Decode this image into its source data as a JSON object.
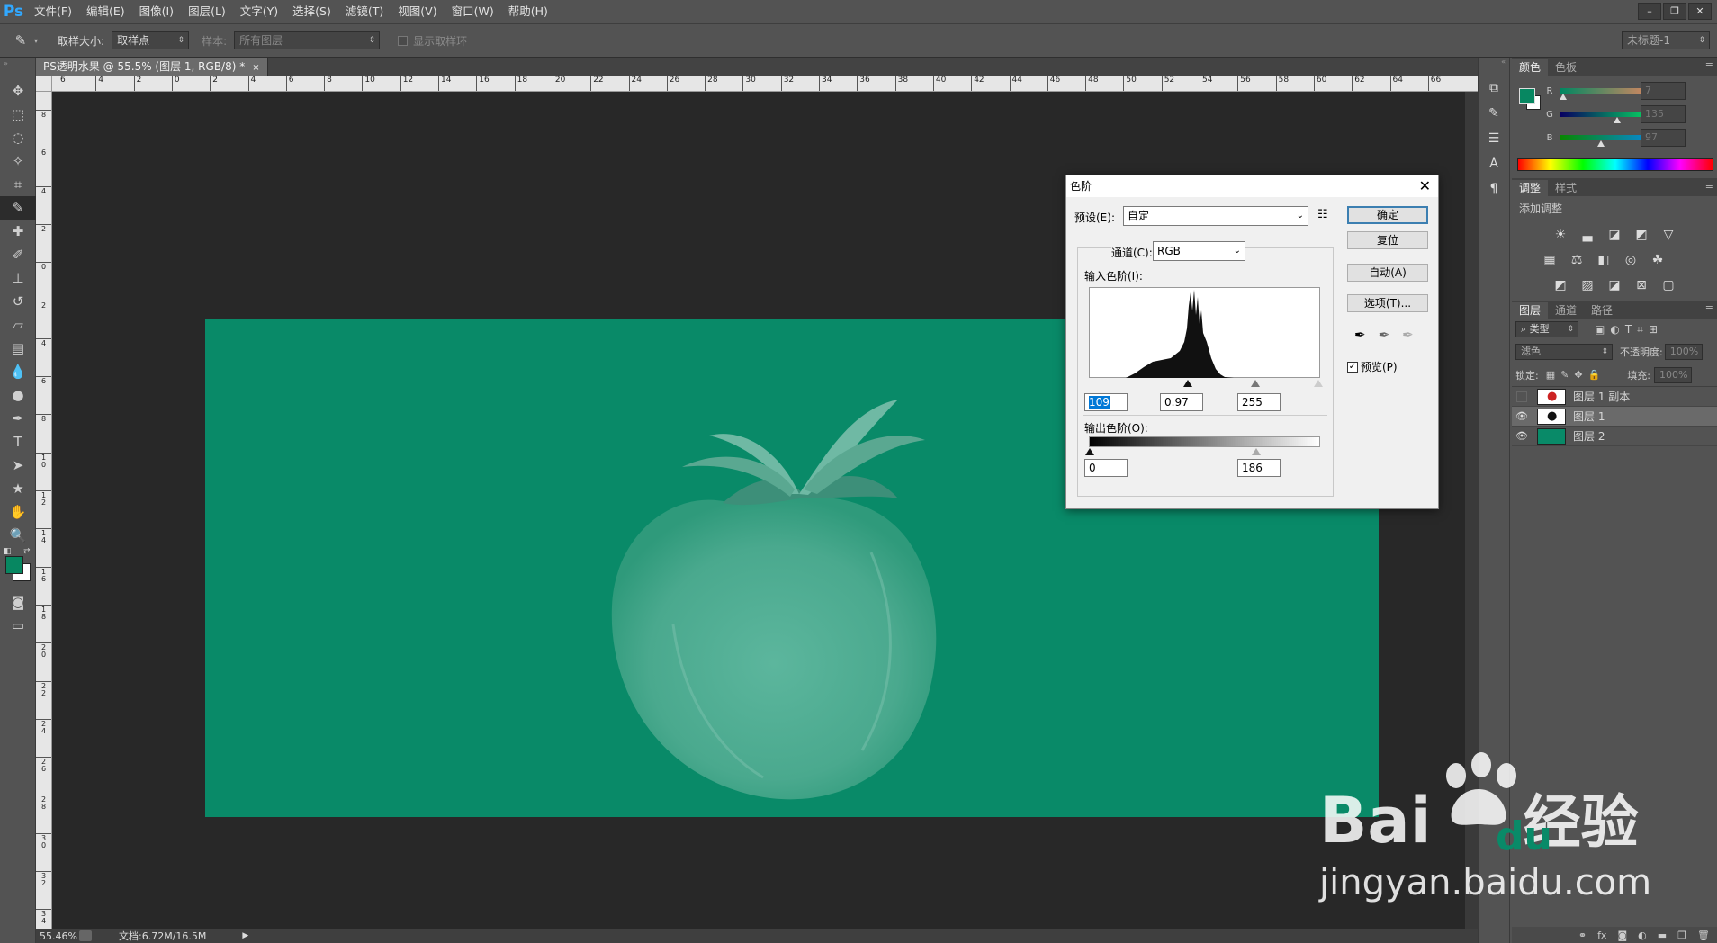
{
  "menubar": {
    "logo": "Ps",
    "items": [
      "文件(F)",
      "编辑(E)",
      "图像(I)",
      "图层(L)",
      "文字(Y)",
      "选择(S)",
      "滤镜(T)",
      "视图(V)",
      "窗口(W)",
      "帮助(H)"
    ]
  },
  "options": {
    "sample_size_label": "取样大小:",
    "sample_size_value": "取样点",
    "sample_label": "样本:",
    "sample_value": "所有图层",
    "show_ring_label": "显示取样环",
    "workspace": "未标题-1"
  },
  "document": {
    "tab_title": "PS透明水果 @ 55.5% (图层 1, RGB/8) *",
    "canvas_color": "#098a68",
    "ruler_h": [
      "6",
      "4",
      "2",
      "0",
      "2",
      "4",
      "6",
      "8",
      "10",
      "12",
      "14",
      "16",
      "18",
      "20",
      "22",
      "24",
      "26",
      "28",
      "30",
      "32",
      "34",
      "36",
      "38",
      "40",
      "42",
      "44",
      "46",
      "48",
      "50",
      "52",
      "54",
      "56",
      "58",
      "60",
      "62",
      "64",
      "66"
    ],
    "ruler_v": [
      "8",
      "6",
      "4",
      "2",
      "0",
      "2",
      "4",
      "6",
      "8",
      "10",
      "12",
      "14",
      "16",
      "18",
      "20",
      "22",
      "24",
      "26",
      "28",
      "30",
      "32",
      "34"
    ]
  },
  "status": {
    "zoom": "55.46%",
    "doc": "文档:6.72M/16.5M"
  },
  "color_panel": {
    "tabs": [
      "颜色",
      "色板"
    ],
    "r_label": "R",
    "g_label": "G",
    "b_label": "B",
    "r": "7",
    "g": "135",
    "b": "97",
    "r_frac": 0.027,
    "g_frac": 0.53,
    "b_frac": 0.38,
    "fg": "#078761",
    "bg": "#ffffff"
  },
  "adjust_panel": {
    "tabs": [
      "调整",
      "样式"
    ],
    "add_label": "添加调整"
  },
  "layers_panel": {
    "tabs": [
      "图层",
      "通道",
      "路径"
    ],
    "filter": "类型",
    "blend": "滤色",
    "opacity_label": "不透明度:",
    "opacity": "100%",
    "lock_label": "锁定:",
    "fill_label": "填充:",
    "fill": "100%",
    "layers": [
      {
        "name": "图层 1 副本",
        "visible": false,
        "selected": false
      },
      {
        "name": "图层 1",
        "visible": true,
        "selected": true
      },
      {
        "name": "图层 2",
        "visible": true,
        "selected": false
      }
    ]
  },
  "levels_dialog": {
    "title": "色阶",
    "preset_label": "预设(E):",
    "preset_value": "自定",
    "channel_label": "通道(C):",
    "channel_value": "RGB",
    "input_label": "输入色阶(I):",
    "input_black": "109",
    "input_gamma": "0.97",
    "input_white": "255",
    "output_label": "输出色阶(O):",
    "output_black": "0",
    "output_white": "186",
    "ok": "确定",
    "reset": "复位",
    "auto": "自动(A)",
    "options": "选项(T)...",
    "preview_label": "预览(P)"
  },
  "watermark": {
    "brand": "Bai",
    "brand2": "du",
    "cn": "经验",
    "url": "jingyan.baidu.com"
  }
}
